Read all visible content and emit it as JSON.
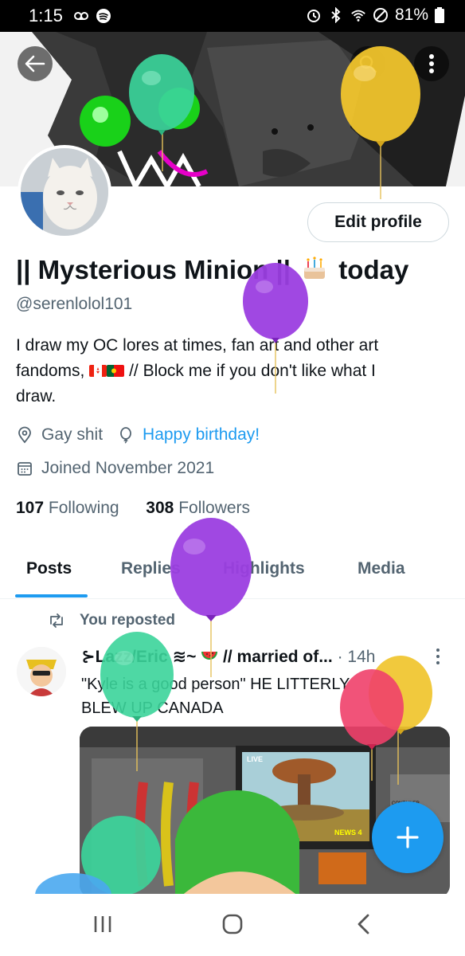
{
  "status_bar": {
    "time": "1:15",
    "battery": "81%"
  },
  "profile": {
    "name_prefix": "|| Mysterious Minion ||",
    "name_suffix": "today",
    "handle": "@serenlolol101",
    "bio_line1": "I draw my OC lores at times, fan art and other art",
    "bio_line2_a": "fandoms,",
    "bio_line2_b": "// Block me if you don't like what I",
    "bio_line3": "draw.",
    "location": "Gay shit",
    "birthday_link": "Happy birthday!",
    "joined": "Joined November 2021",
    "following_count": "107",
    "following_label": "Following",
    "followers_count": "308",
    "followers_label": "Followers",
    "edit_profile_label": "Edit profile"
  },
  "tabs": [
    {
      "label": "Posts"
    },
    {
      "label": "Replies"
    },
    {
      "label": "Highlights"
    },
    {
      "label": "Media"
    }
  ],
  "tweet": {
    "repost_label": "You reposted",
    "author_a": "⊱Lazz/Eric",
    "author_b": "// married of...",
    "time": "· 14h",
    "text_line1": "\"Kyle is a good person\" HE LITTERLY",
    "text_line2": "BLEW UP CANADA",
    "media_tv_label_top": "LIVE",
    "media_tv_label_bottom": "NEWS 4",
    "media_box_label": "CONTAINER"
  },
  "icons": {
    "back": "arrow-left-icon",
    "search": "search-icon",
    "more": "more-vertical-icon",
    "location": "location-pin-icon",
    "birthday": "balloon-icon",
    "calendar": "calendar-icon",
    "repost": "repost-icon",
    "compose": "plus-icon"
  },
  "colors": {
    "accent": "#1d9bf0",
    "text": "#0f1419",
    "muted": "#536471"
  }
}
